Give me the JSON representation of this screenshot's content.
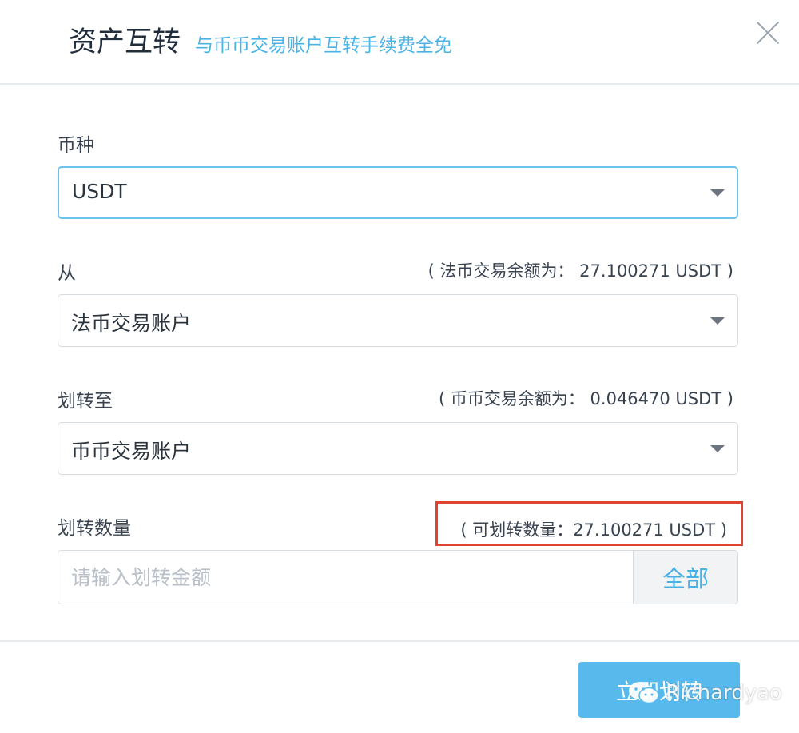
{
  "header": {
    "title": "资产互转",
    "subtitle": "与币币交易账户互转手续费全免"
  },
  "currency": {
    "label": "币种",
    "value": "USDT"
  },
  "from": {
    "label": "从",
    "balance_note": "( 法币交易余额为：  27.100271 USDT )",
    "value": "法币交易账户"
  },
  "to": {
    "label": "划转至",
    "balance_note": "( 币币交易余额为：  0.046470 USDT )",
    "value": "币币交易账户"
  },
  "amount": {
    "label": "划转数量",
    "available_note": "( 可划转数量：27.100271 USDT )",
    "placeholder": "请输入划转金额",
    "all_label": "全部"
  },
  "footer": {
    "submit_label": "立即划转"
  },
  "watermark": {
    "text": "Richardyao"
  },
  "colors": {
    "accent": "#4ab3e6",
    "button": "#58b9ec",
    "highlight": "#e0432f"
  }
}
